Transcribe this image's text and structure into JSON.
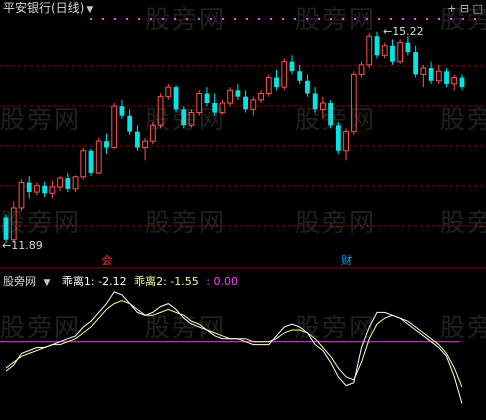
{
  "header": {
    "title": "平安银行(日线)",
    "title_arrow": "▼",
    "corner_controls": "+ ⊟ □"
  },
  "price_panel": {
    "high_label": "15.22",
    "low_label": "11.89",
    "event_marks": [
      {
        "text": "会",
        "color": "#ff3030",
        "index": 13
      },
      {
        "text": "财",
        "color": "#00a0ff",
        "index": 44
      }
    ]
  },
  "indicator": {
    "name": "股旁网",
    "arrow": "▼",
    "items": [
      {
        "label": "乖离1: -2.12",
        "color": "#ffffff"
      },
      {
        "label": "乖离2: -1.55",
        "color": "#ffff99"
      },
      {
        "label": ": 0.00",
        "color": "#ff40ff"
      }
    ]
  },
  "watermark": "股旁网",
  "colors": {
    "up": "#ff5050",
    "down": "#00e5e5",
    "grid": "#8b0000",
    "dot": "#ff40ff",
    "line1": "#ffffff",
    "line2": "#ffff99",
    "zero": "#cc40cc"
  },
  "chart_data": {
    "type": "candlestick",
    "candles": [
      [
        12.3,
        12.35,
        11.89,
        11.95
      ],
      [
        11.95,
        12.55,
        11.92,
        12.45
      ],
      [
        12.45,
        12.9,
        12.4,
        12.85
      ],
      [
        12.85,
        12.95,
        12.6,
        12.7
      ],
      [
        12.7,
        12.85,
        12.65,
        12.8
      ],
      [
        12.8,
        12.86,
        12.62,
        12.68
      ],
      [
        12.68,
        12.88,
        12.6,
        12.78
      ],
      [
        12.78,
        12.95,
        12.72,
        12.92
      ],
      [
        12.92,
        13.0,
        12.7,
        12.75
      ],
      [
        12.75,
        12.96,
        12.7,
        12.94
      ],
      [
        12.94,
        13.4,
        12.9,
        13.35
      ],
      [
        13.35,
        13.38,
        12.95,
        13.0
      ],
      [
        13.0,
        13.55,
        12.98,
        13.5
      ],
      [
        13.5,
        13.62,
        13.3,
        13.4
      ],
      [
        13.4,
        14.1,
        13.38,
        14.05
      ],
      [
        14.05,
        14.15,
        13.85,
        13.9
      ],
      [
        13.9,
        14.0,
        13.6,
        13.65
      ],
      [
        13.65,
        13.75,
        13.35,
        13.4
      ],
      [
        13.4,
        13.55,
        13.2,
        13.5
      ],
      [
        13.5,
        13.8,
        13.45,
        13.75
      ],
      [
        13.75,
        14.25,
        13.7,
        14.2
      ],
      [
        14.2,
        14.4,
        14.15,
        14.35
      ],
      [
        14.35,
        14.38,
        13.95,
        14.0
      ],
      [
        14.0,
        14.05,
        13.7,
        13.75
      ],
      [
        13.75,
        14.0,
        13.72,
        13.95
      ],
      [
        13.95,
        14.3,
        13.9,
        14.25
      ],
      [
        14.25,
        14.35,
        14.05,
        14.1
      ],
      [
        14.1,
        14.25,
        13.9,
        13.95
      ],
      [
        13.95,
        14.15,
        13.92,
        14.1
      ],
      [
        14.1,
        14.35,
        14.05,
        14.3
      ],
      [
        14.3,
        14.4,
        14.15,
        14.2
      ],
      [
        14.2,
        14.3,
        13.95,
        14.0
      ],
      [
        14.0,
        14.2,
        13.9,
        14.15
      ],
      [
        14.15,
        14.3,
        14.1,
        14.25
      ],
      [
        14.25,
        14.55,
        14.2,
        14.5
      ],
      [
        14.5,
        14.62,
        14.3,
        14.35
      ],
      [
        14.35,
        14.8,
        14.3,
        14.75
      ],
      [
        14.75,
        14.85,
        14.55,
        14.6
      ],
      [
        14.6,
        14.7,
        14.4,
        14.45
      ],
      [
        14.45,
        14.55,
        14.2,
        14.25
      ],
      [
        14.25,
        14.35,
        13.95,
        14.0
      ],
      [
        14.0,
        14.2,
        13.85,
        14.1
      ],
      [
        14.1,
        14.15,
        13.7,
        13.75
      ],
      [
        13.75,
        13.8,
        13.3,
        13.35
      ],
      [
        13.35,
        13.7,
        13.2,
        13.65
      ],
      [
        13.65,
        14.6,
        13.6,
        14.55
      ],
      [
        14.55,
        14.75,
        14.5,
        14.7
      ],
      [
        14.7,
        15.2,
        14.65,
        15.15
      ],
      [
        15.15,
        15.22,
        14.8,
        14.85
      ],
      [
        14.85,
        15.05,
        14.8,
        15.0
      ],
      [
        15.0,
        15.1,
        14.7,
        14.75
      ],
      [
        14.75,
        15.1,
        14.72,
        15.05
      ],
      [
        15.05,
        15.15,
        14.85,
        14.9
      ],
      [
        14.9,
        15.0,
        14.5,
        14.55
      ],
      [
        14.55,
        14.7,
        14.35,
        14.65
      ],
      [
        14.65,
        14.75,
        14.4,
        14.45
      ],
      [
        14.45,
        14.7,
        14.4,
        14.6
      ],
      [
        14.6,
        14.65,
        14.35,
        14.4
      ],
      [
        14.4,
        14.55,
        14.3,
        14.5
      ],
      [
        14.5,
        14.55,
        14.3,
        14.35
      ]
    ],
    "deviation_1": [
      -1.0,
      -0.8,
      -0.4,
      -0.3,
      -0.2,
      -0.2,
      -0.1,
      0.0,
      0.1,
      0.2,
      0.5,
      0.7,
      1.0,
      1.3,
      1.7,
      1.6,
      1.3,
      1.0,
      0.9,
      1.0,
      1.2,
      1.3,
      1.1,
      0.8,
      0.6,
      0.5,
      0.4,
      0.2,
      0.1,
      0.1,
      0.1,
      0.0,
      -0.1,
      -0.1,
      -0.1,
      0.2,
      0.5,
      0.6,
      0.5,
      0.3,
      -0.1,
      -0.3,
      -0.7,
      -1.2,
      -1.5,
      -1.4,
      -0.2,
      0.5,
      1.0,
      1.0,
      0.9,
      0.8,
      0.6,
      0.4,
      0.2,
      0.0,
      -0.2,
      -0.5,
      -1.2,
      -2.12
    ],
    "deviation_2": [
      -0.9,
      -0.7,
      -0.5,
      -0.4,
      -0.3,
      -0.2,
      -0.1,
      -0.1,
      0.0,
      0.1,
      0.3,
      0.5,
      0.8,
      1.1,
      1.3,
      1.4,
      1.3,
      1.1,
      0.9,
      0.9,
      1.0,
      1.1,
      1.0,
      0.9,
      0.7,
      0.6,
      0.4,
      0.3,
      0.2,
      0.1,
      0.1,
      0.1,
      0.0,
      0.0,
      0.0,
      0.1,
      0.3,
      0.4,
      0.4,
      0.3,
      0.1,
      -0.2,
      -0.5,
      -0.9,
      -1.2,
      -1.3,
      -0.7,
      0.1,
      0.6,
      0.8,
      0.9,
      0.8,
      0.7,
      0.5,
      0.3,
      0.1,
      -0.1,
      -0.4,
      -0.9,
      -1.55
    ],
    "zero_line": 0.0,
    "price_range": [
      11.6,
      15.5
    ],
    "indicator_range": [
      -2.4,
      1.9
    ]
  }
}
